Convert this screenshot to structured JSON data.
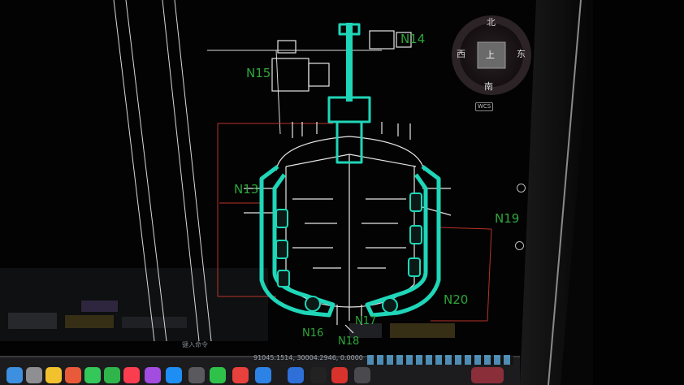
{
  "cad": {
    "nozzle_labels": [
      "N14",
      "N15",
      "N13",
      "N19",
      "N20",
      "N16",
      "N17",
      "N18"
    ],
    "viewcube": {
      "north": "北",
      "south": "南",
      "west": "西",
      "east": "东",
      "top_face": "上",
      "wcs_label": "WCS"
    },
    "status_coords": "91045.1514, 30004.2946, 0.0000",
    "command_hint": "键入命令"
  },
  "colors": {
    "vessel_jacket": "#1fd6b8",
    "nozzle_label": "#2ea63a",
    "reference_line": "#c0392b",
    "geometry": "#e8e8e8",
    "background": "#060606"
  },
  "dock": {
    "icons": [
      "finder-icon",
      "launchpad-icon",
      "photos-icon",
      "facetime-icon",
      "messages-icon",
      "music-icon",
      "podcasts-icon",
      "app-store-icon",
      "settings-icon",
      "wechat-icon",
      "wps-icon",
      "search-icon",
      "notes-icon",
      "qq-icon",
      "autocad-icon",
      "terminal-icon",
      "downloads-icon",
      "trash-icon"
    ]
  }
}
